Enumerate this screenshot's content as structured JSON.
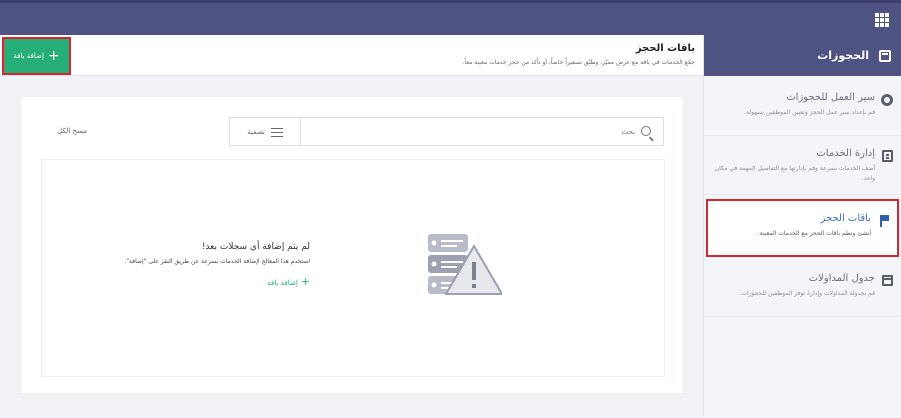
{
  "topbar": {
    "apps_icon": "grid-icon"
  },
  "nav": {
    "header": {
      "title": "الحجوزات",
      "icon": "calendar-icon"
    },
    "items": [
      {
        "title": "سير العمل للحجوزات",
        "desc": "قم بإعداد سير عمل الحجز وتعيين الموظفين بسهولة.",
        "icon": "gear-icon"
      },
      {
        "title": "إدارة الخدمات",
        "desc": "أضف الخدمات بسرعة وقم بإدارتها مع التفاصيل المهمة في مكان واحد.",
        "icon": "document-icon"
      },
      {
        "title": "باقات الحجز",
        "desc": "أنشئ ونظم باقات الحجز مع الخدمات المعينة.",
        "icon": "flag-icon",
        "active": true
      },
      {
        "title": "جدول المداولات",
        "desc": "قم بجدولة المداولات وإدارة توفر الموظفين للحجوزات.",
        "icon": "calendar-icon"
      }
    ]
  },
  "page": {
    "title": "باقات الحجز",
    "subtitle": "جمّع الخدمات في باقة مع عرض مميّز، وطبّق تسعيراً خاصاً، أو تأكد من حجز خدمات معينة معاً.",
    "add_button": "إضافة باقة"
  },
  "toolbar": {
    "search_placeholder": "بحث",
    "filter_label": "تصفية",
    "clear_all": "مسح الكل"
  },
  "empty_state": {
    "title": "لم يتم إضافة أي سجلات بعد!",
    "description": "استخدم هذا المعالج لإضافة الخدمات بسرعة عن طريق النقر على \"إضافة\".",
    "add_link": "إضافة باقة"
  },
  "colors": {
    "primary": "#4f5382",
    "accent": "#27ae78",
    "highlight": "#d7262e",
    "link": "#3f70b8"
  }
}
